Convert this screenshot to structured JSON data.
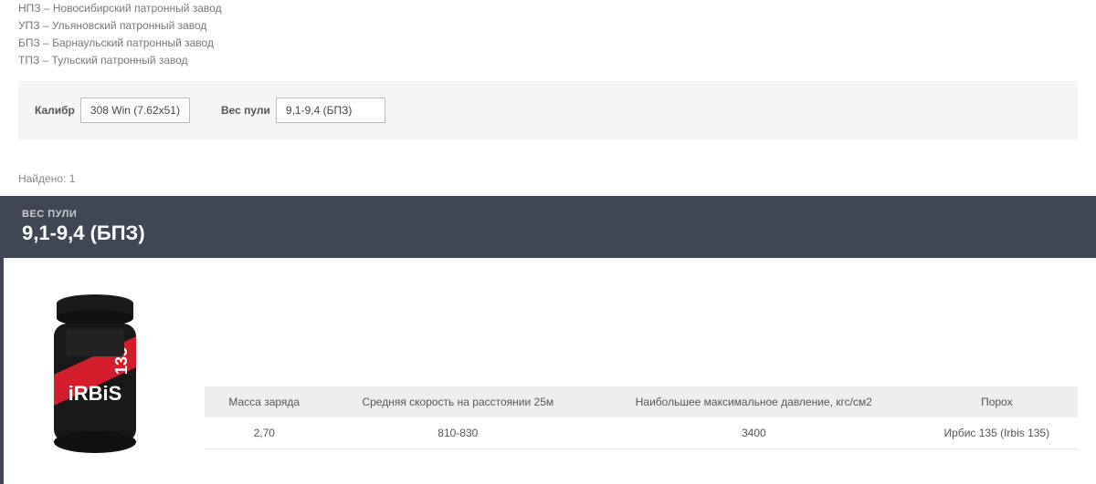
{
  "legend": {
    "items": [
      "НПЗ – Новосибирский патронный завод",
      "УПЗ – Ульяновский патронный завод",
      "БПЗ – Барнаульский патронный завод",
      "ТПЗ – Тульский патронный завод"
    ]
  },
  "filters": {
    "caliber_label": "Калибр",
    "caliber_value": "308 Win (7.62x51)",
    "weight_label": "Вес пули",
    "weight_value": "9,1-9,4 (БПЗ)"
  },
  "found_text": "Найдено: 1",
  "result": {
    "header_label": "ВЕС ПУЛИ",
    "header_value": "9,1-9,4 (БПЗ)",
    "product_name": "iRBiS 135",
    "table": {
      "headers": [
        "Масса заряда",
        "Средняя скорость на расстоянии 25м",
        "Наибольшее максимальное давление, кгс/см2",
        "Порох"
      ],
      "row": [
        "2,70",
        "810-830",
        "3400",
        "Ирбис 135 (Irbis 135)"
      ]
    }
  }
}
